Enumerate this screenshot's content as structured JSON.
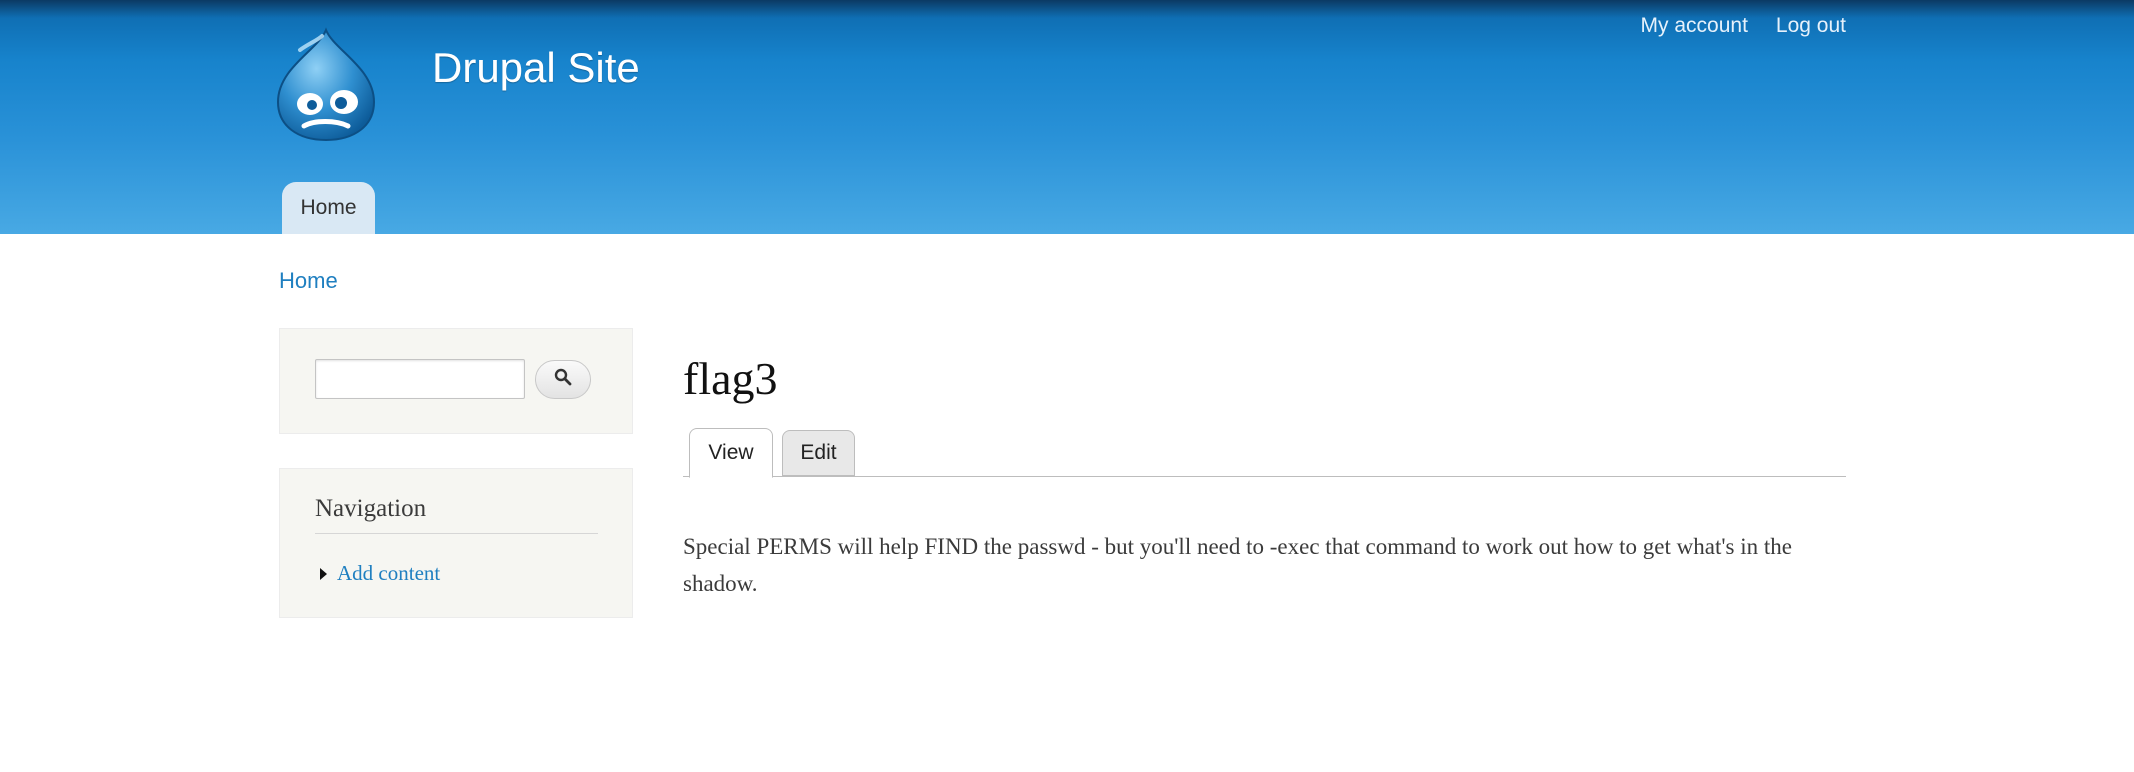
{
  "header": {
    "site_name": "Drupal Site",
    "secondary_menu": [
      "My account",
      "Log out"
    ],
    "main_menu": [
      "Home"
    ]
  },
  "breadcrumb": "Home",
  "sidebar": {
    "search": {
      "value": "",
      "button_icon": "search-icon"
    },
    "navigation": {
      "title": "Navigation",
      "items": [
        "Add content"
      ]
    }
  },
  "main": {
    "title": "flag3",
    "tabs": [
      "View",
      "Edit"
    ],
    "active_tab": "View",
    "body": "Special PERMS will help FIND the passwd - but you'll need to -exec that command to work out how to get what's in the shadow."
  },
  "colors": {
    "header_top": "#0b3a63",
    "header_bottom": "#48a9e4",
    "link": "#1f7fc0",
    "sidebar_bg": "#f6f6f2"
  }
}
